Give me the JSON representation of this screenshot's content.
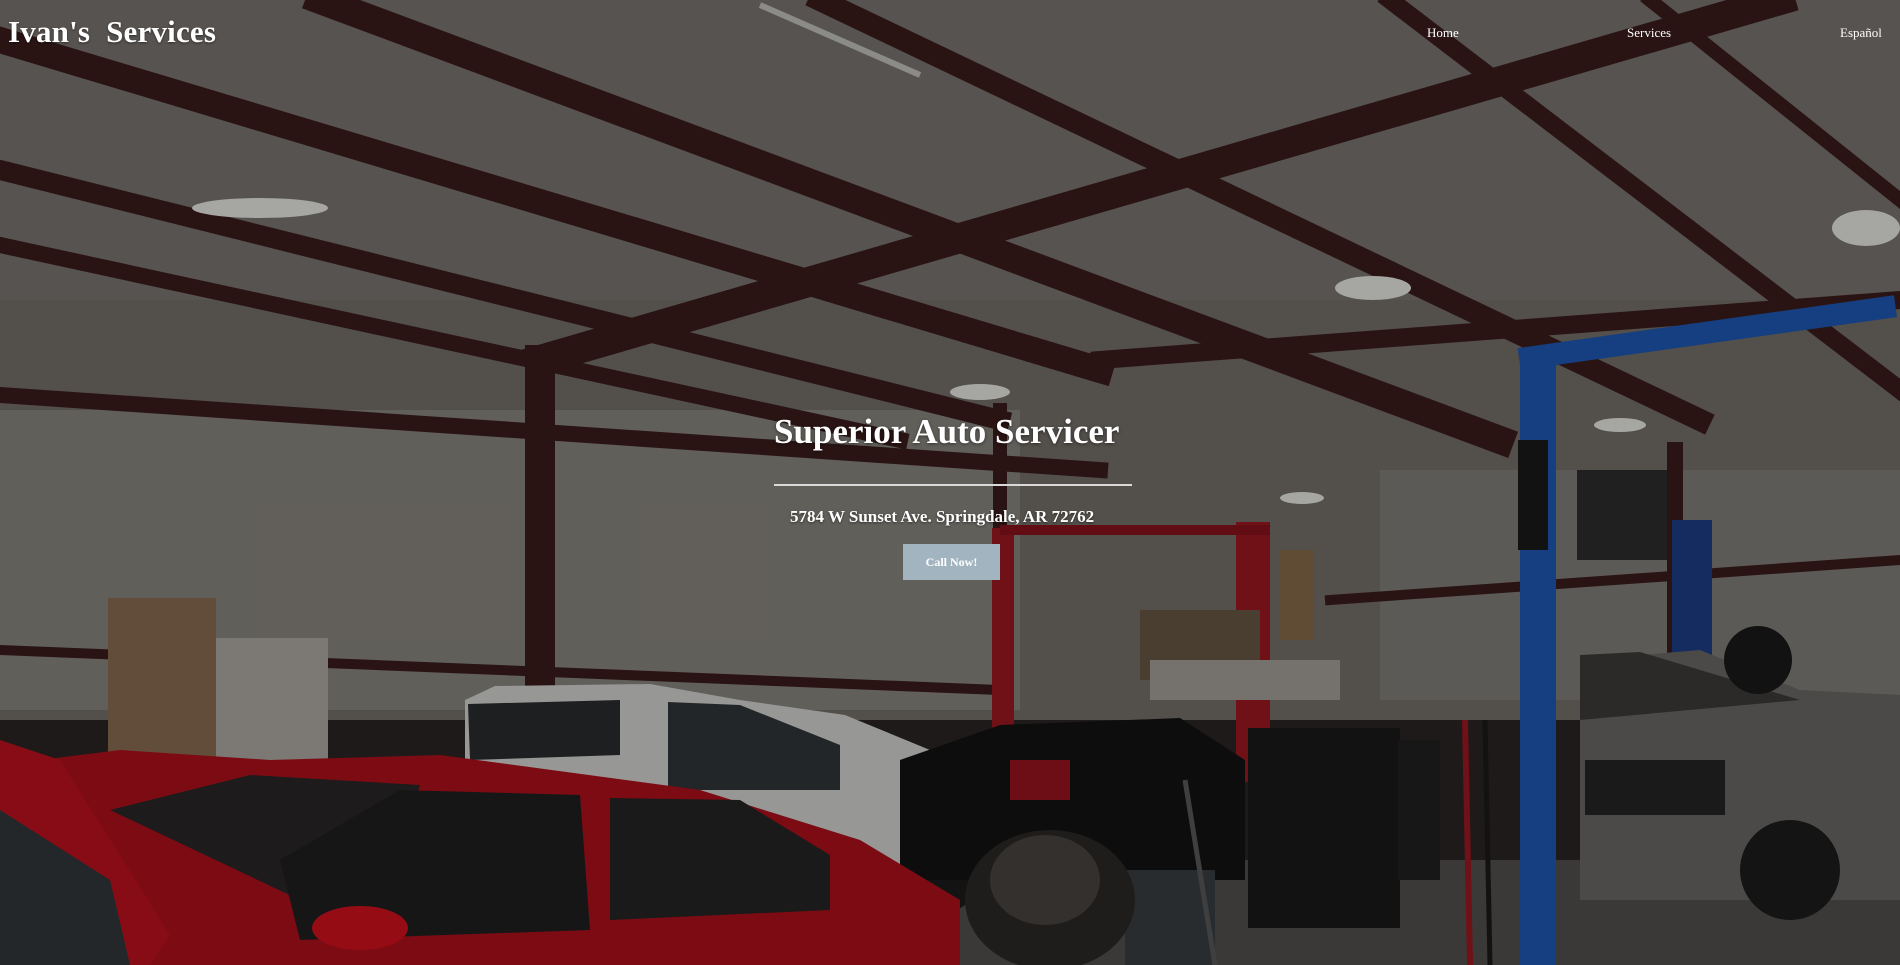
{
  "header": {
    "brand": "Ivan's  Services",
    "nav": [
      {
        "label": "Home"
      },
      {
        "label": "Services"
      },
      {
        "label": "Español"
      }
    ]
  },
  "hero": {
    "title": "Superior Auto Servicer",
    "address": "5784 W Sunset Ave. Springdale, AR 72762",
    "cta_label": "Call Now!",
    "background_scene": "garage-interior-with-cars-and-lifts"
  },
  "colors": {
    "cta_background": "#a3b4c1",
    "text": "#ffffff",
    "divider": "#d9d9d9",
    "lift_red": "#a11822",
    "lift_blue": "#1f5bb8",
    "car_red": "#b3101c",
    "steel_beam": "#3c1e1c"
  }
}
